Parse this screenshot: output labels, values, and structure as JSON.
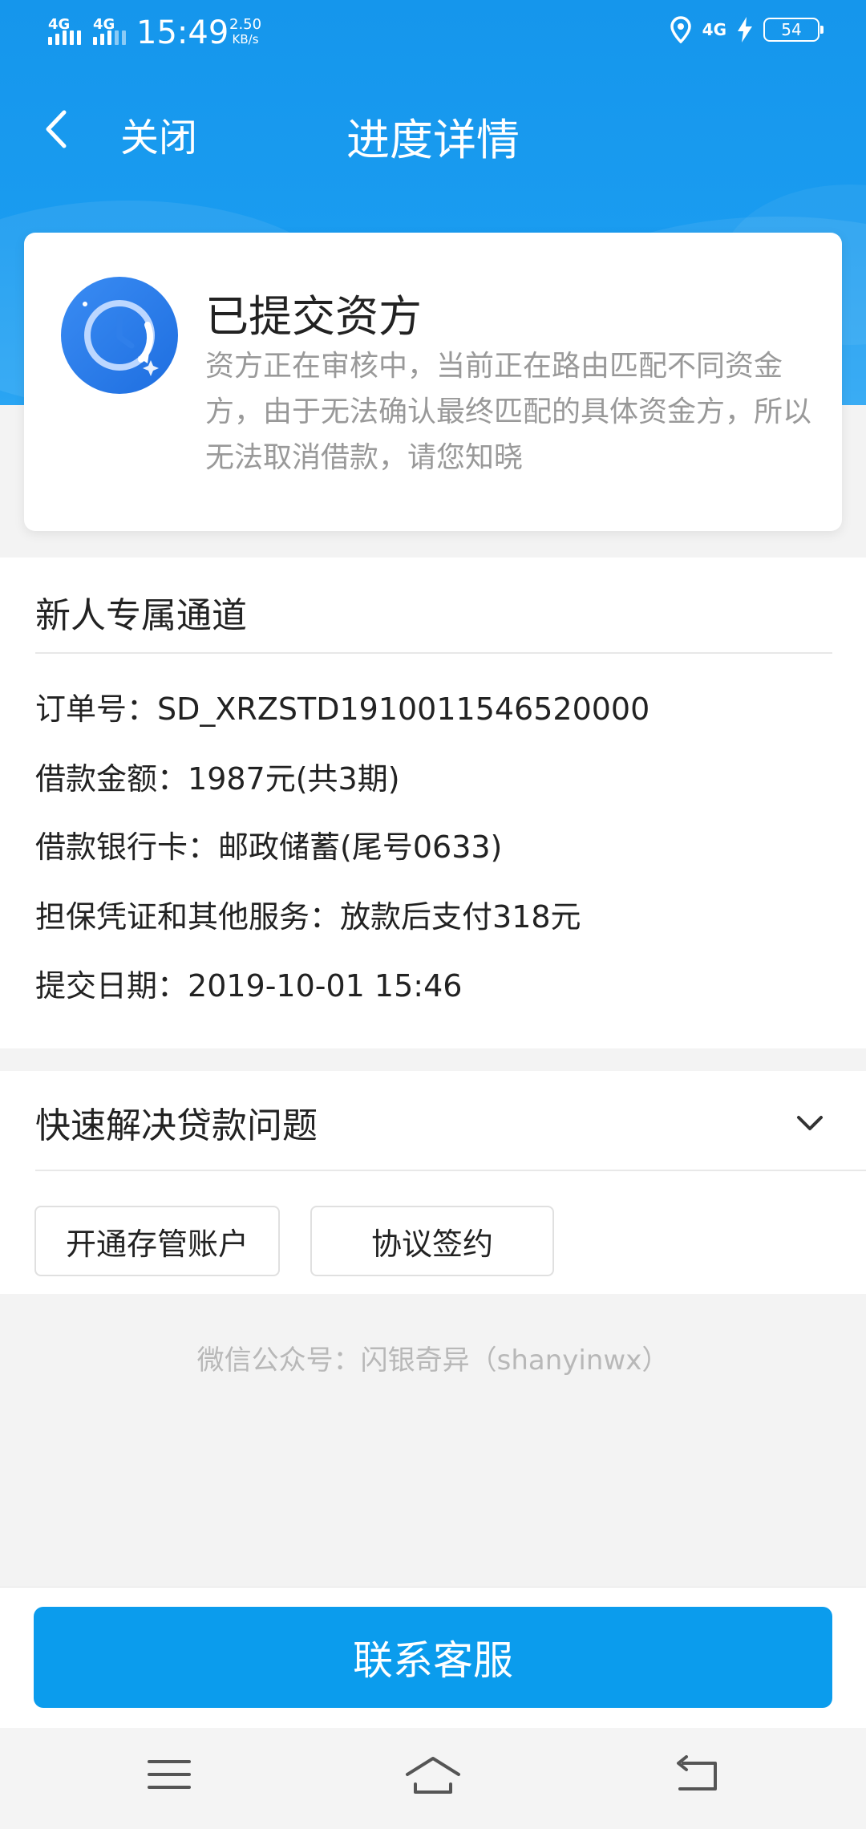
{
  "status_bar": {
    "signal1": "4G",
    "signal2": "4G",
    "time": "15:49",
    "speed_value": "2.50",
    "speed_unit": "KB/s",
    "network": "4G",
    "battery": "54"
  },
  "nav": {
    "close_label": "关闭",
    "title": "进度详情"
  },
  "status_card": {
    "title": "已提交资方",
    "description": "资方正在审核中，当前正在路由匹配不同资金方，由于无法确认最终匹配的具体资金方，所以无法取消借款，请您知晓"
  },
  "order": {
    "channel": "新人专属通道",
    "rows": [
      {
        "label": "订单号：",
        "value": "SD_XRZSTD1910011546520000"
      },
      {
        "label": "借款金额：",
        "value": "1987元(共3期)"
      },
      {
        "label": "借款银行卡：",
        "value": "邮政储蓄(尾号0633)"
      },
      {
        "label": "担保凭证和其他服务：",
        "value": "放款后支付318元"
      },
      {
        "label": "提交日期：",
        "value": "2019-10-01 15:46"
      }
    ]
  },
  "quick": {
    "title": "快速解决贷款问题",
    "buttons": [
      "开通存管账户",
      "协议签约"
    ]
  },
  "footer_note": "微信公众号：闪银奇异（shanyinwx）",
  "contact_button": "联系客服",
  "colors": {
    "header_blue": "#1596ec",
    "button_blue": "#0b9ced"
  }
}
